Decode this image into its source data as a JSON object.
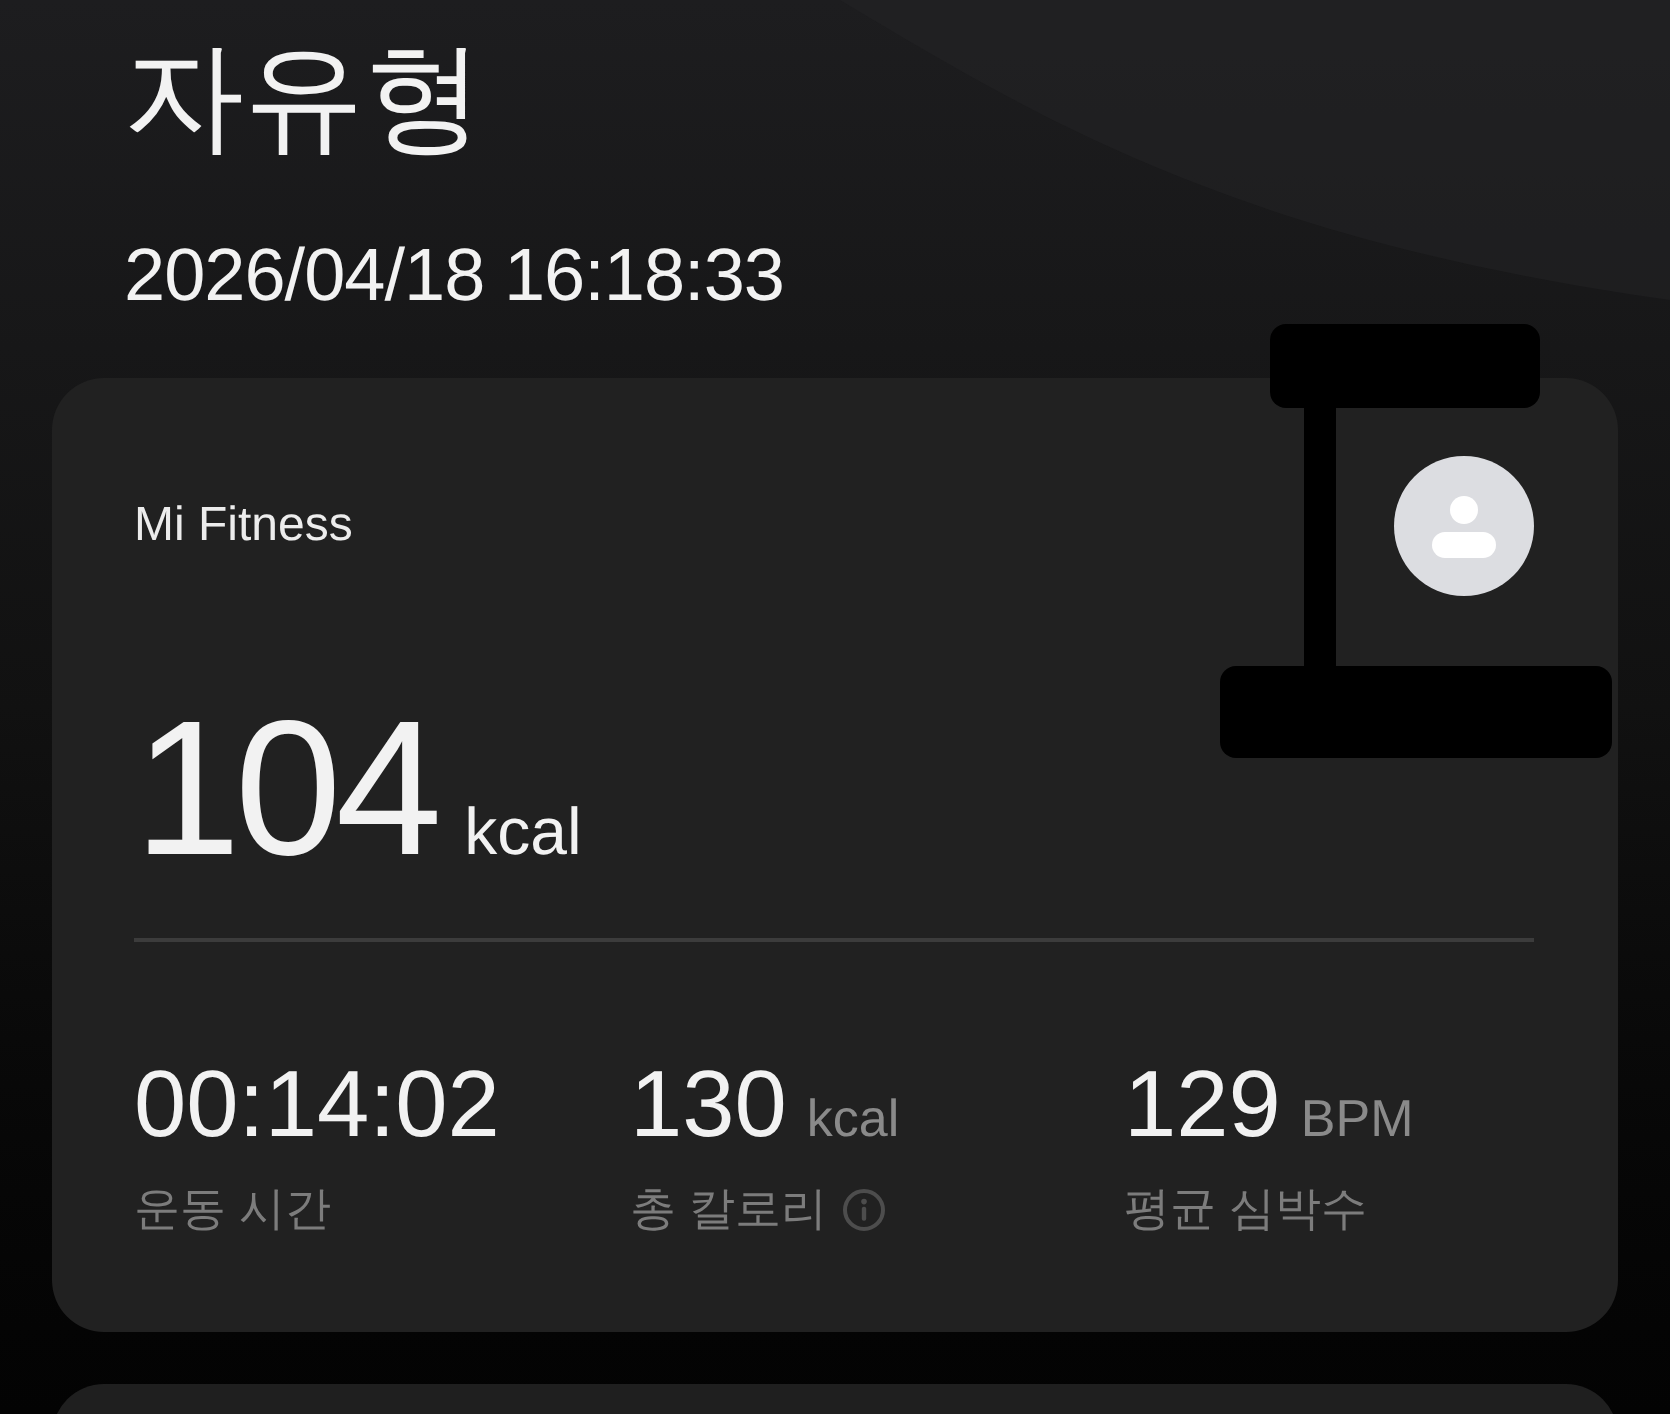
{
  "header": {
    "title": "자유형",
    "datetime": "2026/04/18 16:18:33"
  },
  "summary_card": {
    "source": "Mi Fitness",
    "calories": {
      "value": "104",
      "unit": "kcal"
    },
    "stats": [
      {
        "value": "00:14:02",
        "label": "운동 시간",
        "info": false
      },
      {
        "value": "130",
        "unit": "kcal",
        "label": "총 칼로리",
        "info": true
      },
      {
        "value": "129",
        "unit": "BPM",
        "label": "평균 심박수",
        "info": false
      }
    ]
  }
}
